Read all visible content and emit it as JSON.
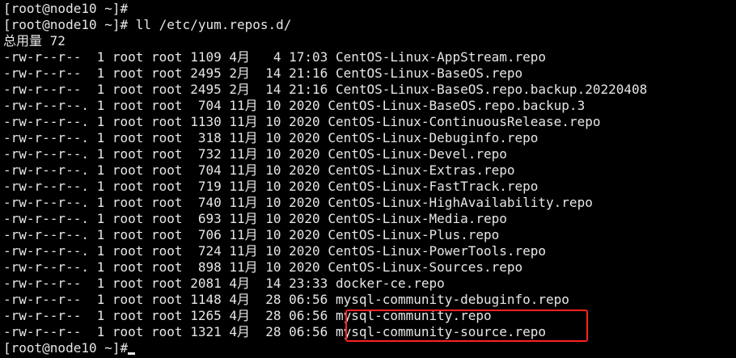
{
  "terminal": {
    "colors": {
      "background": "#000000",
      "foreground": "#e6e6e6",
      "highlight_border": "#ff2020"
    },
    "lines": [
      "[root@node10 ~]#",
      "[root@node10 ~]# ll /etc/yum.repos.d/",
      "总用量 72",
      "-rw-r--r--  1 root root 1109 4月   4 17:03 CentOS-Linux-AppStream.repo",
      "-rw-r--r--  1 root root 2495 2月  14 21:16 CentOS-Linux-BaseOS.repo",
      "-rw-r--r--  1 root root 2495 2月  14 21:16 CentOS-Linux-BaseOS.repo.backup.20220408",
      "-rw-r--r--. 1 root root  704 11月 10 2020 CentOS-Linux-BaseOS.repo.backup.3",
      "-rw-r--r--. 1 root root 1130 11月 10 2020 CentOS-Linux-ContinuousRelease.repo",
      "-rw-r--r--. 1 root root  318 11月 10 2020 CentOS-Linux-Debuginfo.repo",
      "-rw-r--r--. 1 root root  732 11月 10 2020 CentOS-Linux-Devel.repo",
      "-rw-r--r--. 1 root root  704 11月 10 2020 CentOS-Linux-Extras.repo",
      "-rw-r--r--. 1 root root  719 11月 10 2020 CentOS-Linux-FastTrack.repo",
      "-rw-r--r--. 1 root root  740 11月 10 2020 CentOS-Linux-HighAvailability.repo",
      "-rw-r--r--. 1 root root  693 11月 10 2020 CentOS-Linux-Media.repo",
      "-rw-r--r--. 1 root root  706 11月 10 2020 CentOS-Linux-Plus.repo",
      "-rw-r--r--. 1 root root  724 11月 10 2020 CentOS-Linux-PowerTools.repo",
      "-rw-r--r--. 1 root root  898 11月 10 2020 CentOS-Linux-Sources.repo",
      "-rw-r--r--  1 root root 2081 4月  14 23:33 docker-ce.repo",
      "-rw-r--r--  1 root root 1148 4月  28 06:56 mysql-community-debuginfo.repo",
      "-rw-r--r--  1 root root 1265 4月  28 06:56 mysql-community.repo",
      "-rw-r--r--  1 root root 1321 4月  28 06:56 mysql-community-source.repo"
    ],
    "final_prompt": "[root@node10 ~]#"
  }
}
